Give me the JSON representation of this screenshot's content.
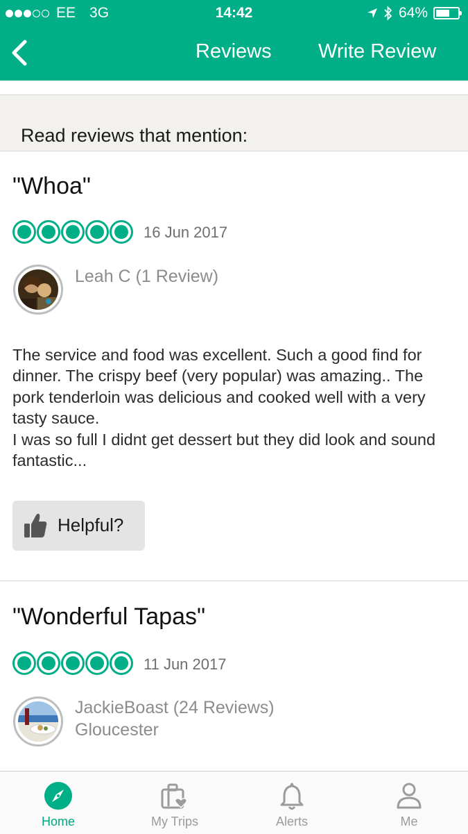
{
  "status_bar": {
    "carrier": "EE",
    "network": "3G",
    "time": "14:42",
    "battery": "64%",
    "battery_level": 0.64
  },
  "nav": {
    "back_icon": "chevron-left-icon",
    "reviews_label": "Reviews",
    "write_review_label": "Write Review"
  },
  "section": {
    "mention_label": "Read reviews that mention:"
  },
  "reviews": [
    {
      "title": "\"Whoa\"",
      "rating": 5,
      "date": "16 Jun 2017",
      "author": "Leah C (1 Review)",
      "location": "",
      "body": "The service and food was excellent. Such a good find for dinner. The crispy beef (very popular) was amazing.. The pork tenderloin was delicious and cooked well with a very tasty sauce.\nI was so full I didnt get dessert but they did look and sound fantastic...",
      "helpful_label": "Helpful?"
    },
    {
      "title": "\"Wonderful Tapas\"",
      "rating": 5,
      "date": "11 Jun 2017",
      "author": "JackieBoast (24 Reviews)",
      "location": "Gloucester"
    }
  ],
  "tabs": [
    {
      "label": "Home",
      "icon": "compass-icon",
      "active": true
    },
    {
      "label": "My Trips",
      "icon": "suitcase-heart-icon",
      "active": false
    },
    {
      "label": "Alerts",
      "icon": "bell-icon",
      "active": false
    },
    {
      "label": "Me",
      "icon": "person-icon",
      "active": false
    }
  ],
  "colors": {
    "brand": "#00af87",
    "inactive_tab": "#9b9b9b"
  }
}
